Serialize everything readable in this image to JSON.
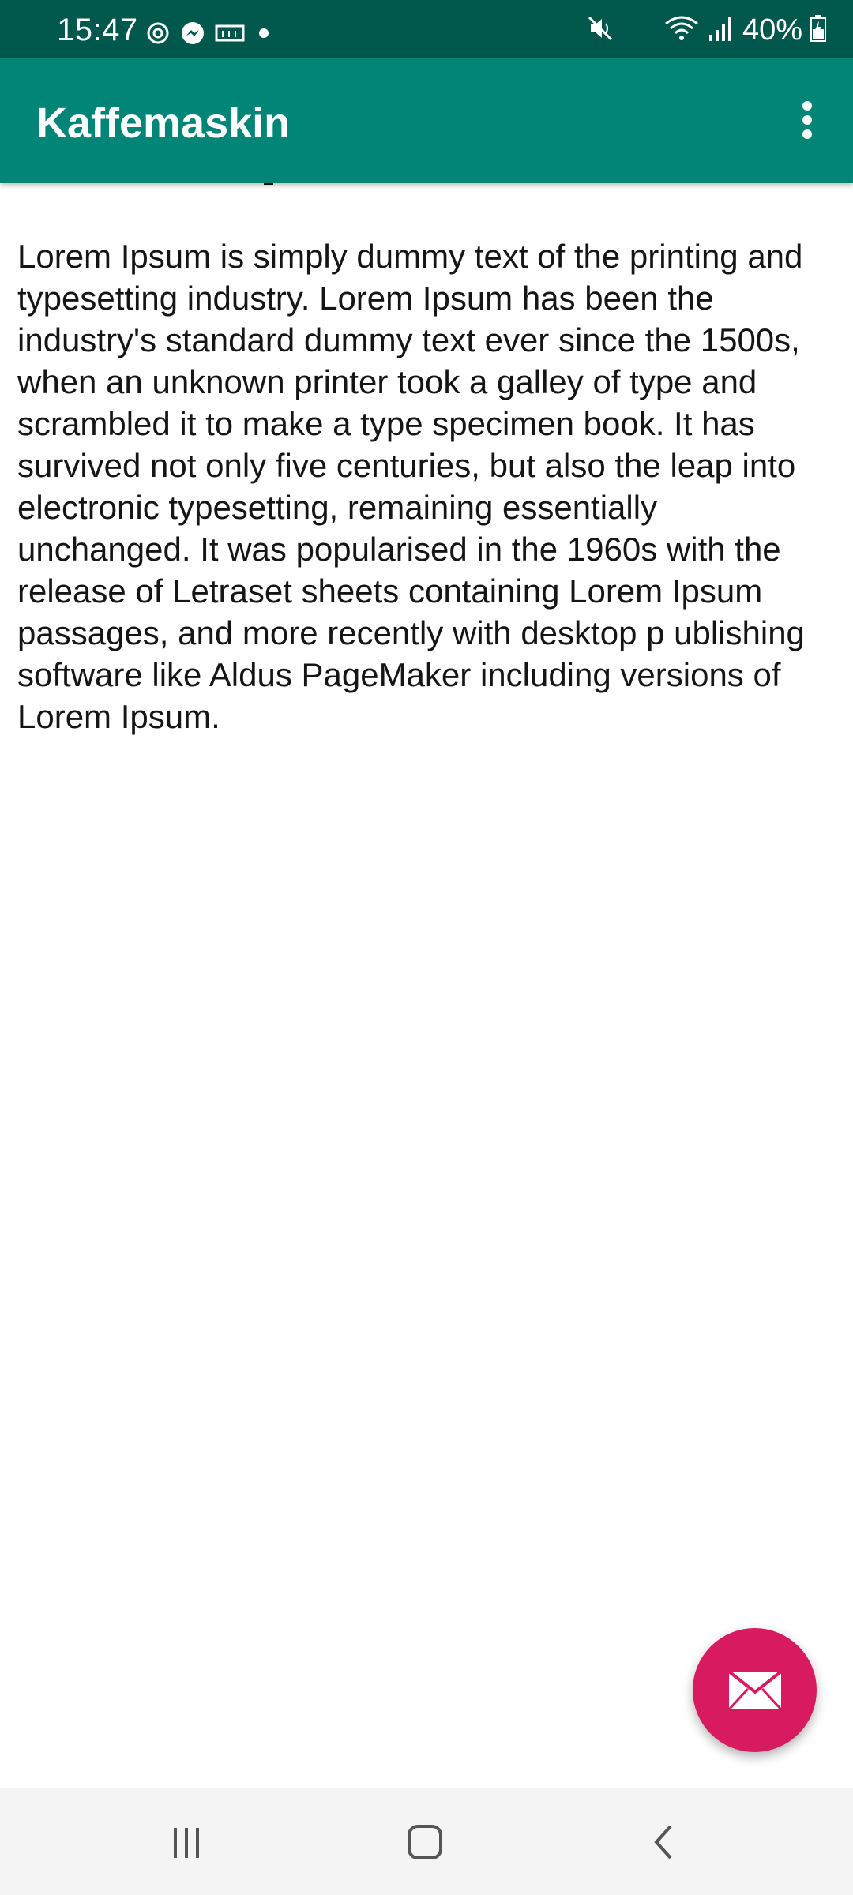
{
  "status_bar": {
    "time": "15:47",
    "left_icons": [
      "sync-icon",
      "messenger-icon",
      "keyboard-icon",
      "dot-icon"
    ],
    "right_icons": [
      "mute-icon",
      "wifi-icon",
      "signal-icon",
      "battery-charging-icon"
    ],
    "battery": "40%"
  },
  "app_bar": {
    "title": "Kaffemaskin",
    "menu_icon": "overflow-menu-icon"
  },
  "content": {
    "body": "Lorem Ipsum is simply dummy text of the printing and typesetting industry. Lorem Ipsum has been the industry's standard dummy text ever since the 1500s, when an unknown printer took a galley of type and scrambled it to make a type specimen book. It has survived not only five centuries, but also the leap into electronic typesetting, remaining essentially unchanged. It was popularised in the 1960s with the release of Letraset sheets containing Lorem Ipsum passages, and more recently with desktop p ublishing software like Aldus PageMaker including versions of Lorem Ipsum."
  },
  "fab": {
    "icon": "email-icon"
  },
  "nav_bar": {
    "buttons": [
      "recents-icon",
      "home-icon",
      "back-icon"
    ]
  },
  "colors": {
    "status_bar": "#00574b",
    "app_bar": "#008577",
    "fab": "#d81b60",
    "nav_bar": "#f4f4f4"
  }
}
